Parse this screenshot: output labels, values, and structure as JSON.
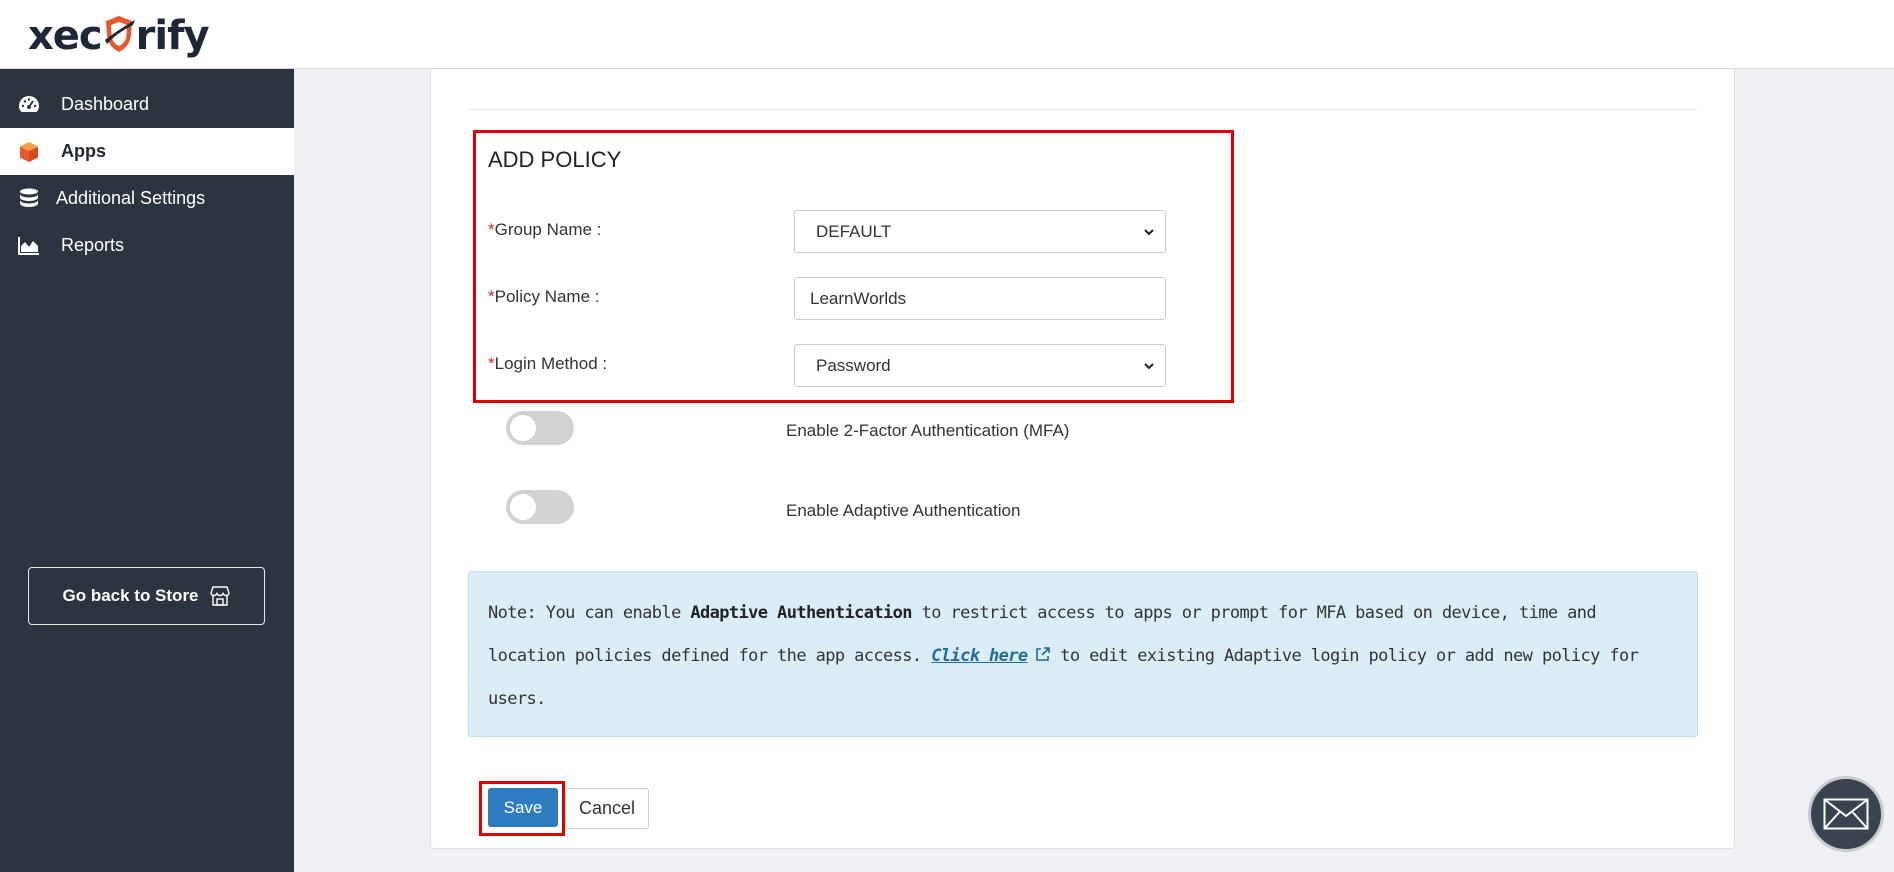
{
  "brand": {
    "logo_text_left": "xec",
    "logo_text_right": "rify",
    "accent": "#e8582a"
  },
  "sidebar": {
    "items": [
      {
        "label": "Dashboard",
        "icon": "dashboard-gauge-icon"
      },
      {
        "label": "Apps",
        "icon": "cube-icon",
        "active": true
      },
      {
        "label": "Additional Settings",
        "icon": "database-icon"
      },
      {
        "label": "Reports",
        "icon": "area-chart-icon"
      }
    ],
    "store_button": {
      "label": "Go back to Store",
      "icon": "store-icon"
    }
  },
  "form": {
    "title": "ADD POLICY",
    "required_mark": "*",
    "group_name": {
      "label": "Group Name :",
      "value": "DEFAULT"
    },
    "policy_name": {
      "label": "Policy Name :",
      "value": "LearnWorlds"
    },
    "login_method": {
      "label": "Login Method :",
      "value": "Password"
    },
    "mfa_toggle": {
      "label": "Enable 2-Factor Authentication (MFA)",
      "on": false
    },
    "adaptive_toggle": {
      "label": "Enable Adaptive Authentication",
      "on": false
    }
  },
  "note": {
    "prefix": "Note: You can enable ",
    "bold": "Adaptive Authentication",
    "middle": " to restrict access to apps or prompt for MFA based on device, time and location policies defined for the app access. ",
    "link": "Click here",
    "suffix": " to edit existing Adaptive login policy or add new policy for users."
  },
  "actions": {
    "save_label": "Save",
    "cancel_label": "Cancel"
  },
  "colors": {
    "sidebar_bg": "#2c3440",
    "primary": "#2d7cc0",
    "highlight": "#e00000",
    "note_bg": "#dbedf7"
  }
}
